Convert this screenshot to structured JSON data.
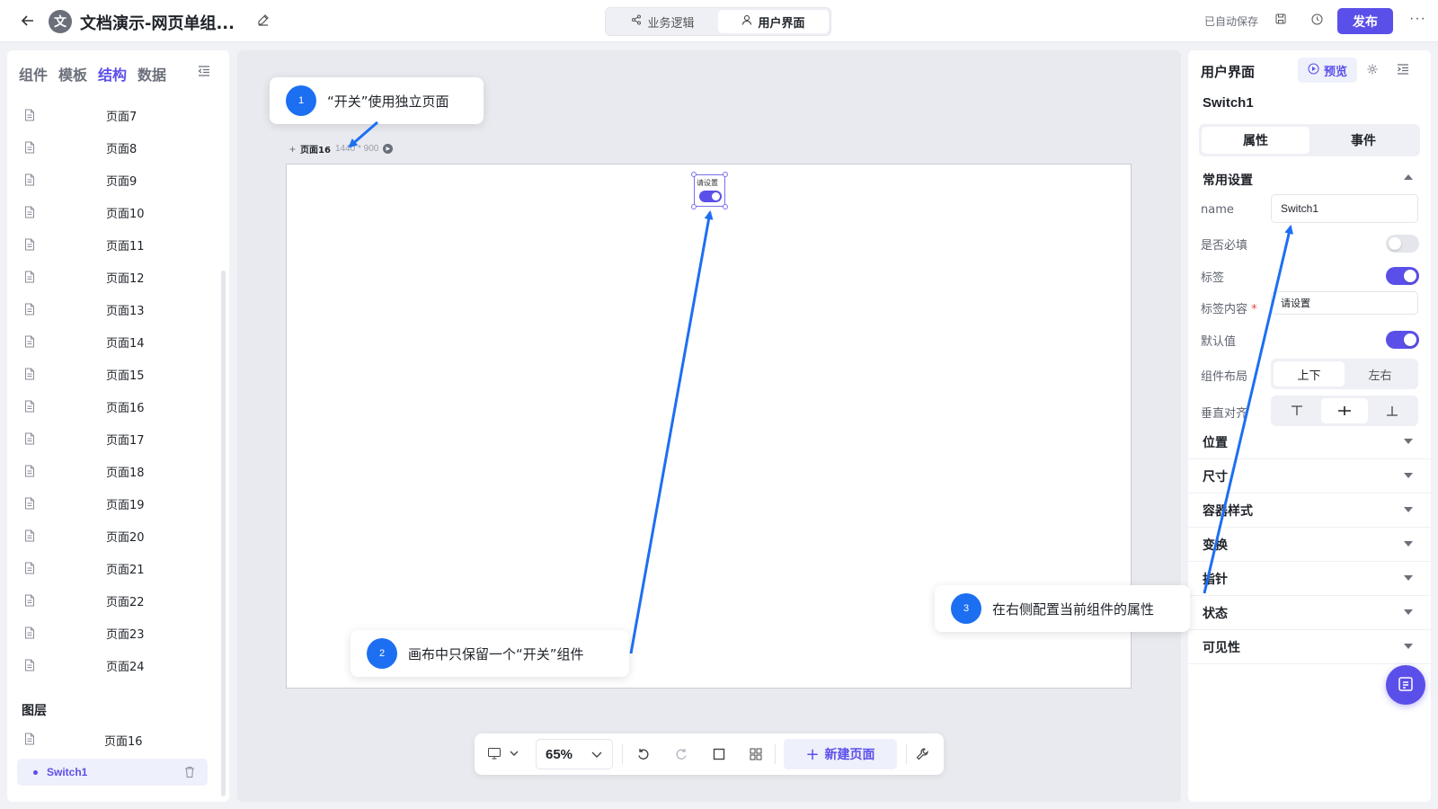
{
  "topbar": {
    "avatar_char": "文",
    "title": "文档演示-网页单组...",
    "mode_tabs": [
      {
        "label": "业务逻辑",
        "icon": "share-nodes-icon",
        "active": false
      },
      {
        "label": "用户界面",
        "icon": "user-icon",
        "active": true
      }
    ],
    "autosave": "已自动保存",
    "publish": "发布"
  },
  "left_panel": {
    "tabs": [
      "组件",
      "模板",
      "结构",
      "数据"
    ],
    "active_tab": "结构",
    "pages": [
      "页面7",
      "页面8",
      "页面9",
      "页面10",
      "页面11",
      "页面12",
      "页面13",
      "页面14",
      "页面15",
      "页面16",
      "页面17",
      "页面18",
      "页面19",
      "页面20",
      "页面21",
      "页面22",
      "页面23",
      "页面24"
    ],
    "layers_title": "图层",
    "layer_page": "页面16",
    "layer_component": "Switch1"
  },
  "canvas": {
    "page_name": "页面16",
    "page_size": "1440 * 900",
    "widget_label": "请设置"
  },
  "bottom_toolbar": {
    "zoom": "65%",
    "new_page": "新建页面"
  },
  "right_panel": {
    "title": "用户界面",
    "preview": "预览",
    "component_name": "Switch1",
    "tabs": [
      "属性",
      "事件"
    ],
    "active_tab": "属性",
    "common_section": "常用设置",
    "name_label": "name",
    "name_value": "Switch1",
    "required_label": "是否必填",
    "required_on": false,
    "label_label": "标签",
    "label_on": true,
    "label_content_label": "标签内容",
    "label_content_value": "请设置",
    "default_label": "默认值",
    "default_on": true,
    "layout_label": "组件布局",
    "layout_options": [
      "上下",
      "左右"
    ],
    "layout_selected": "上下",
    "valign_label": "垂直对齐",
    "valign_options": [
      "align-top-icon",
      "align-middle-icon",
      "align-bottom-icon"
    ],
    "valign_selected": "align-middle-icon",
    "sections": [
      "位置",
      "尺寸",
      "容器样式",
      "变换",
      "指针",
      "状态",
      "可见性"
    ]
  },
  "callouts": [
    {
      "num": "1",
      "text": "“开关”使用独立页面"
    },
    {
      "num": "2",
      "text": "画布中只保留一个“开关”组件"
    },
    {
      "num": "3",
      "text": "在右侧配置当前组件的属性"
    }
  ],
  "colors": {
    "accent": "#5b4fe9",
    "callout_blue": "#1d6ff2"
  }
}
